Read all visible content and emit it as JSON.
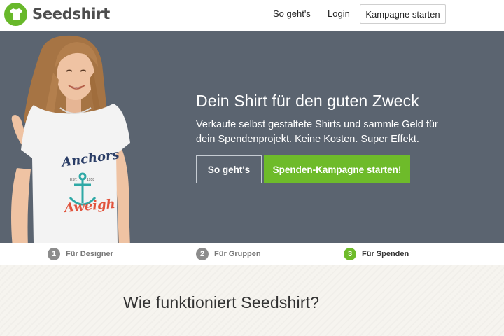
{
  "header": {
    "logo_text": "Seedshirt",
    "logo_icon": "shirt-icon",
    "nav": [
      {
        "label": "So geht's"
      },
      {
        "label": "Login"
      }
    ],
    "cta_label": "Kampagne starten"
  },
  "hero": {
    "title": "Dein Shirt für den guten Zweck",
    "subtitle": "Verkaufe selbst gestaltete Shirts und sammle Geld für dein Spendenprojekt. Keine Kosten. Super Effekt.",
    "secondary_button": "So geht's",
    "primary_button": "Spenden-Kampagne starten!",
    "shirt_print": {
      "line1": "Anchors",
      "line2": "Aweigh",
      "est_left": "EST.",
      "est_right": "1958"
    }
  },
  "steps": [
    {
      "number": "1",
      "label": "Für Designer",
      "active": false
    },
    {
      "number": "2",
      "label": "Für Gruppen",
      "active": false
    },
    {
      "number": "3",
      "label": "Für Spenden",
      "active": true
    }
  ],
  "section": {
    "title": "Wie funktioniert Seedshirt?"
  },
  "colors": {
    "brand_green": "#6ebb2a",
    "hero_background": "#5b6470",
    "step_inactive": "#8c8c8c",
    "section_background": "#f6f4ef"
  }
}
